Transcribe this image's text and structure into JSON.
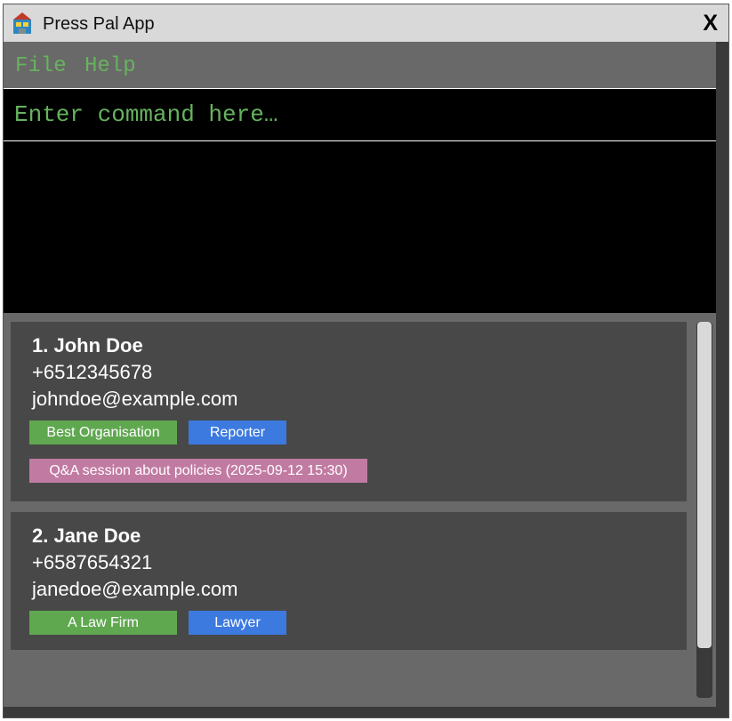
{
  "window": {
    "title": "Press Pal App",
    "close_label": "X"
  },
  "menu": {
    "items": [
      "File",
      "Help"
    ]
  },
  "command": {
    "placeholder": "Enter command here…",
    "value": ""
  },
  "result": {
    "text": ""
  },
  "persons": [
    {
      "index_name": "1. John Doe",
      "phone": "+6512345678",
      "email": "johndoe@example.com",
      "tags": [
        "Best Organisation",
        "Reporter"
      ],
      "events": [
        "Q&A session about policies (2025-09-12 15:30)"
      ]
    },
    {
      "index_name": "2. Jane Doe",
      "phone": "+6587654321",
      "email": "janedoe@example.com",
      "tags": [
        "A Law Firm",
        "Lawyer"
      ],
      "events": []
    }
  ],
  "colors": {
    "menu_text": "#66b35e",
    "organisation_tag": "#60a850",
    "role_tag": "#3c7ae0",
    "event_tag": "#c17ba2",
    "card_bg": "#484848",
    "panel_bg": "#696969"
  }
}
